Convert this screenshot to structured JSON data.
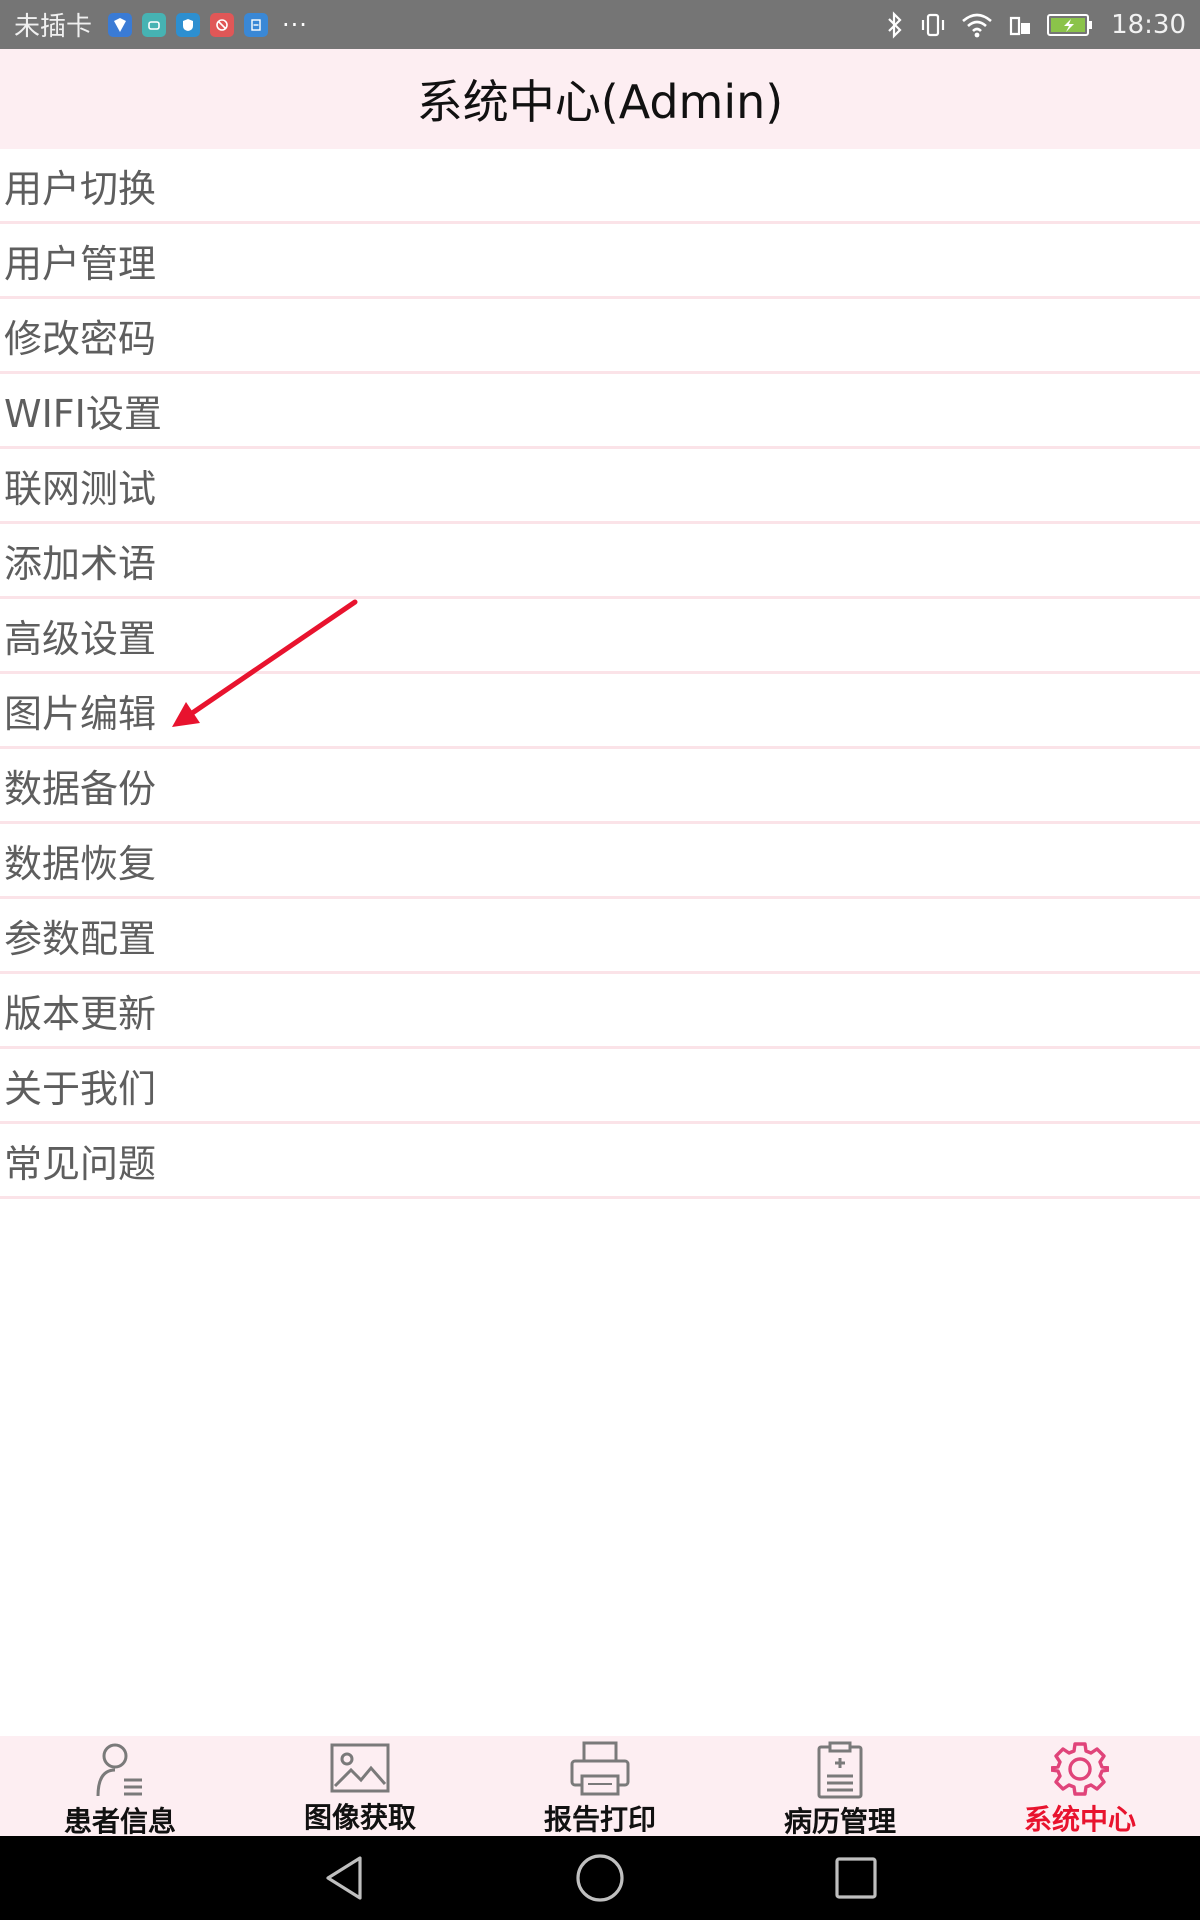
{
  "status_bar": {
    "carrier": "未插卡",
    "overflow": "···",
    "time": "18:30",
    "notif_icons": [
      "shield-check-icon",
      "android-icon",
      "security-icon",
      "blocked-icon",
      "document-icon"
    ],
    "right_icons": [
      "bluetooth-icon",
      "vibrate-icon",
      "wifi-icon",
      "sim-icon",
      "battery-charging-icon"
    ]
  },
  "header": {
    "title": "系统中心(Admin)"
  },
  "menu": {
    "items": [
      {
        "label": "用户切换"
      },
      {
        "label": "用户管理"
      },
      {
        "label": "修改密码"
      },
      {
        "label": "WIFI设置"
      },
      {
        "label": "联网测试"
      },
      {
        "label": "添加术语"
      },
      {
        "label": "高级设置"
      },
      {
        "label": "图片编辑"
      },
      {
        "label": "数据备份"
      },
      {
        "label": "数据恢复"
      },
      {
        "label": "参数配置"
      },
      {
        "label": "版本更新"
      },
      {
        "label": "关于我们"
      },
      {
        "label": "常见问题"
      }
    ]
  },
  "tabs": [
    {
      "label": "患者信息",
      "icon": "patient-icon",
      "active": false
    },
    {
      "label": "图像获取",
      "icon": "image-icon",
      "active": false
    },
    {
      "label": "报告打印",
      "icon": "printer-icon",
      "active": false
    },
    {
      "label": "病历管理",
      "icon": "clipboard-icon",
      "active": false
    },
    {
      "label": "系统中心",
      "icon": "gear-icon",
      "active": true
    }
  ],
  "colors": {
    "status_bar_bg": "#757575",
    "header_bg": "#fdeef2",
    "divider": "#fbe3e8",
    "menu_text": "#5e5e5e",
    "active_tab": "#e8132e",
    "active_icon": "#e0447a",
    "inactive_icon": "#7a7a7a",
    "annotation": "#e8132e"
  },
  "nav_bar": [
    "back-icon",
    "home-icon",
    "recents-icon"
  ]
}
